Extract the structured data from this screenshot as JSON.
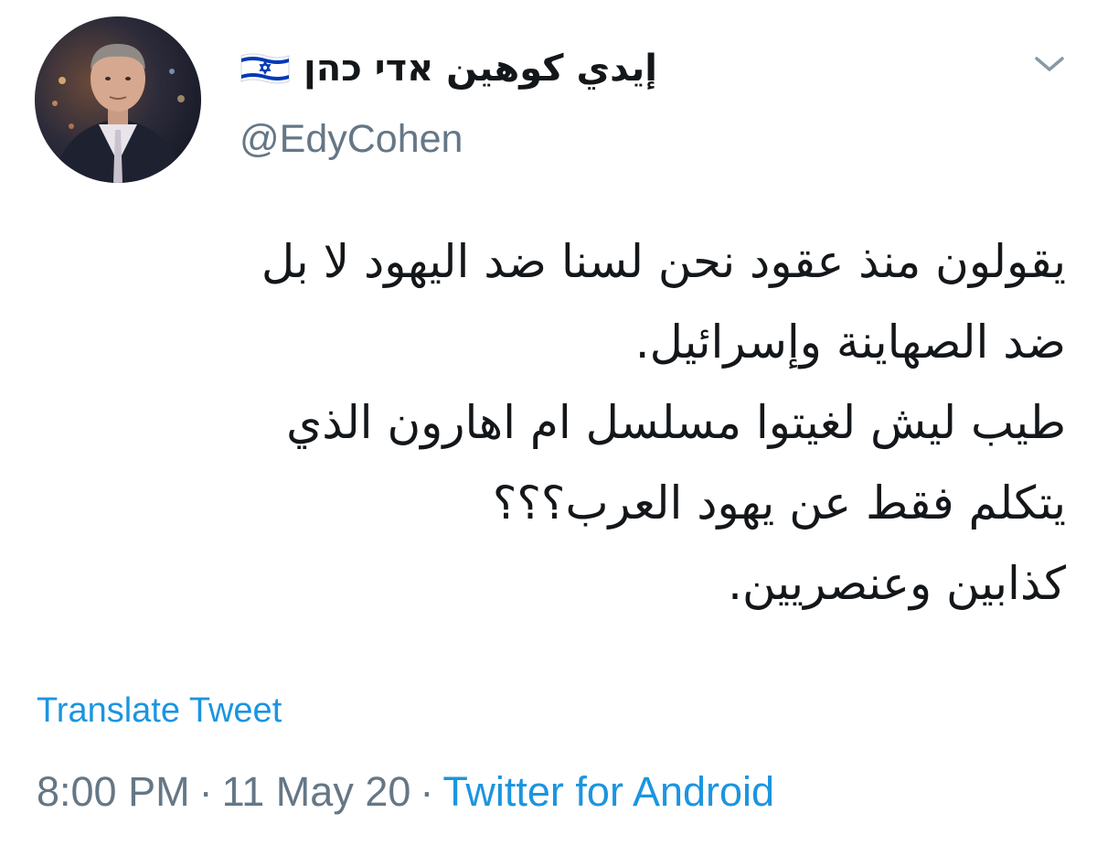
{
  "author": {
    "display_name": "إيدي كوهين אדי כהן",
    "handle": "@EdyCohen",
    "avatar": "profile-photo",
    "flag": "israel-flag-icon"
  },
  "menu_icon": "chevron-down-icon",
  "tweet": {
    "lines": [
      "يقولون منذ عقود نحن لسنا ضد اليهود لا بل",
      "ضد الصهاينة وإسرائيل.",
      "طيب ليش لغيتوا مسلسل ام اهارون الذي",
      "يتكلم فقط عن يهود العرب؟؟؟",
      "كذابين وعنصريين."
    ],
    "translate_label": "Translate Tweet",
    "time": "8:00 PM",
    "separator": "·",
    "date": "11 May 20",
    "source": "Twitter for Android"
  },
  "colors": {
    "link": "#1b95e0",
    "secondary_text": "#657786",
    "primary_text": "#14171a",
    "flag_blue": "#0038b8"
  }
}
